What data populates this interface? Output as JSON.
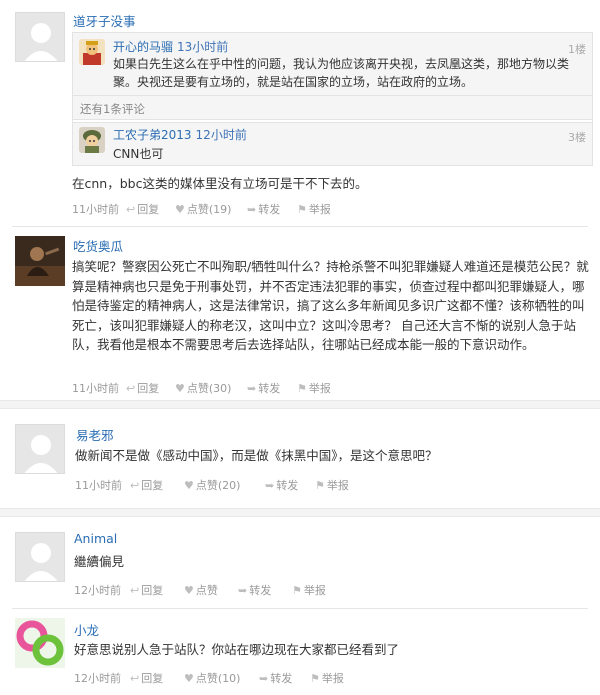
{
  "comments": [
    {
      "user": "道牙子没事",
      "reply_box": {
        "first_reply": {
          "user": "开心的马骝",
          "time": "13小时前",
          "floor": "1楼",
          "text": "如果白先生这么在乎中性的问题，我认为他应该离开央视，去凤凰这类，那地方物以类聚。央视还是要有立场的，就是站在国家的立场，站在政府的立场。"
        },
        "more_link": "还有1条评论",
        "last_reply": {
          "user": "工农子弟2013",
          "time": "12小时前",
          "floor": "3楼",
          "text": "CNN也可"
        }
      },
      "text": "在cnn，bbc这类的媒体里没有立场可是干不下去的。",
      "time": "11小时前",
      "reply_label": "回复",
      "like_label": "点赞(19)",
      "share_label": "转发",
      "report_label": "举报"
    },
    {
      "user": "吃货奥瓜",
      "text": "搞笑呢？警察因公死亡不叫殉职/牺牲叫什么？持枪杀警不叫犯罪嫌疑人难道还是模范公民？就算是精神病也只是免于刑事处罚，并不否定违法犯罪的事实，侦查过程中都叫犯罪嫌疑人，哪怕是待鉴定的精神病人，这是法律常识，搞了这么多年新闻见多识广这都不懂？该称牺牲的叫死亡，该叫犯罪嫌疑人的称老汉，这叫中立？这叫冷思考？ 自己还大言不惭的说别人急于站队，我看他是根本不需要思考后去选择站队，往哪站已经成本能一般的下意识动作。",
      "time": "11小时前",
      "reply_label": "回复",
      "like_label": "点赞(30)",
      "share_label": "转发",
      "report_label": "举报"
    },
    {
      "user": "易老邪",
      "text": "做新闻不是做《感动中国》，而是做《抹黑中国》，是这个意思吧？",
      "time": "11小时前",
      "reply_label": "回复",
      "like_label": "点赞(20)",
      "share_label": "转发",
      "report_label": "举报"
    },
    {
      "user": "Animal",
      "text": "繼續偏見",
      "time": "12小时前",
      "reply_label": "回复",
      "like_label": "点赞",
      "share_label": "转发",
      "report_label": "举报"
    },
    {
      "user": "小龙",
      "text": "好意思说别人急于站队？你站在哪边现在大家都已经看到了",
      "time": "12小时前",
      "reply_label": "回复",
      "like_label": "点赞(10)",
      "share_label": "转发",
      "report_label": "举报"
    }
  ],
  "colors": {
    "username": "#2a6db3",
    "meta": "#9a9a9a",
    "text": "#333333",
    "nest_bg": "#f5f5f5"
  },
  "icons": {
    "reply": "reply-arrow-icon",
    "like": "heart-icon",
    "share": "share-arrow-icon",
    "report": "report-icon"
  }
}
